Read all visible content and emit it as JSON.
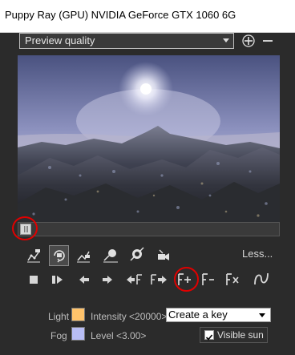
{
  "window": {
    "title": "Puppy Ray (GPU)  NVIDIA GeForce GTX 1060 6G"
  },
  "quality": {
    "selected": "Preview quality"
  },
  "toolbar": {
    "less_label": "Less..."
  },
  "light": {
    "label": "Light",
    "intensity_label": "Intensity <20000>",
    "color": "#ffc36b"
  },
  "fog": {
    "label": "Fog",
    "level_label": "Level <3.00>",
    "color": "#b8bdf5"
  },
  "key_select": {
    "selected": "Create a key"
  },
  "visible_sun": {
    "label": "Visible sun",
    "checked": true
  },
  "icons": [
    "plus-icon",
    "minus-icon",
    "camera-path-icon",
    "rotate-camera-icon",
    "camera-target-icon",
    "sun-icon",
    "sphere-icon",
    "camera-icon",
    "stop-icon",
    "play-icon",
    "arrow-left-icon",
    "arrow-right-icon",
    "previous-key-icon",
    "next-key-icon",
    "add-key-icon",
    "remove-key-icon",
    "delete-key-icon",
    "curve-icon"
  ]
}
